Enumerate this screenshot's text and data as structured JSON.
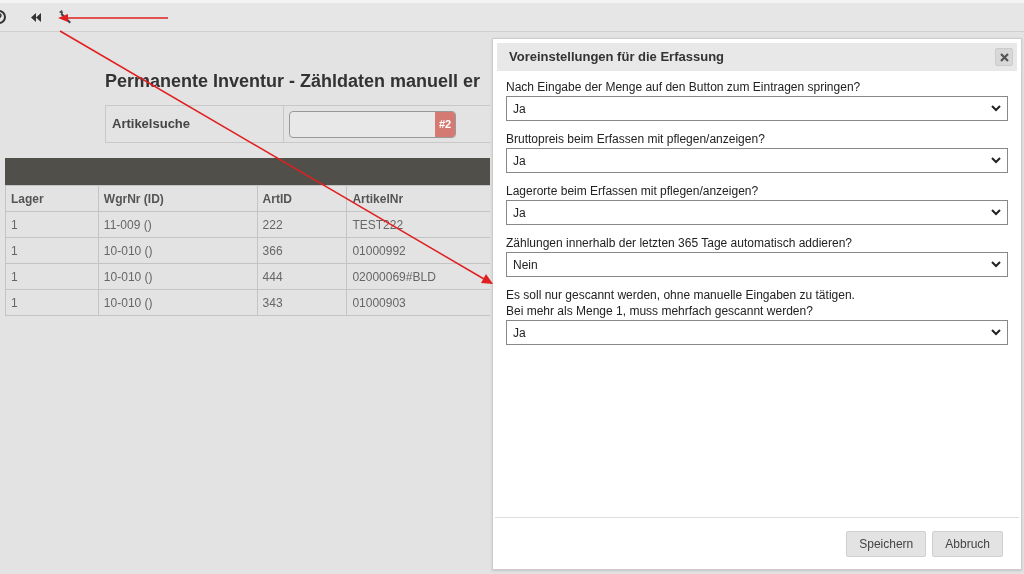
{
  "page": {
    "title": "Permanente Inventur - Zähldaten manuell er"
  },
  "search": {
    "label": "Artikelsuche",
    "badge": "#2"
  },
  "table": {
    "columns": [
      "Lager",
      "WgrNr (ID)",
      "ArtID",
      "ArtikelNr"
    ],
    "rows": [
      [
        "1",
        "11-009 ()",
        "222",
        "TEST222"
      ],
      [
        "1",
        "10-010 ()",
        "366",
        "01000992"
      ],
      [
        "1",
        "10-010 ()",
        "444",
        "02000069#BLD"
      ],
      [
        "1",
        "10-010 ()",
        "343",
        "01000903"
      ]
    ]
  },
  "dialog": {
    "title": "Voreinstellungen für die Erfassung",
    "fields": [
      {
        "label_lines": [
          "Nach Eingabe der Menge auf den Button zum Eintragen springen?"
        ],
        "value": "Ja"
      },
      {
        "label_lines": [
          "Bruttopreis beim Erfassen mit pflegen/anzeigen?"
        ],
        "value": "Ja"
      },
      {
        "label_lines": [
          "Lagerorte beim Erfassen mit pflegen/anzeigen?"
        ],
        "value": "Ja"
      },
      {
        "label_lines": [
          "Zählungen innerhalb der letzten 365 Tage automatisch addieren?"
        ],
        "value": "Nein"
      },
      {
        "label_lines": [
          "Es soll nur gescannt werden, ohne manuelle Eingaben zu tätigen.",
          "Bei mehr als Menge 1, muss mehrfach gescannt werden?"
        ],
        "value": "Ja"
      }
    ],
    "buttons": [
      "Speichern",
      "Abbruch"
    ]
  }
}
